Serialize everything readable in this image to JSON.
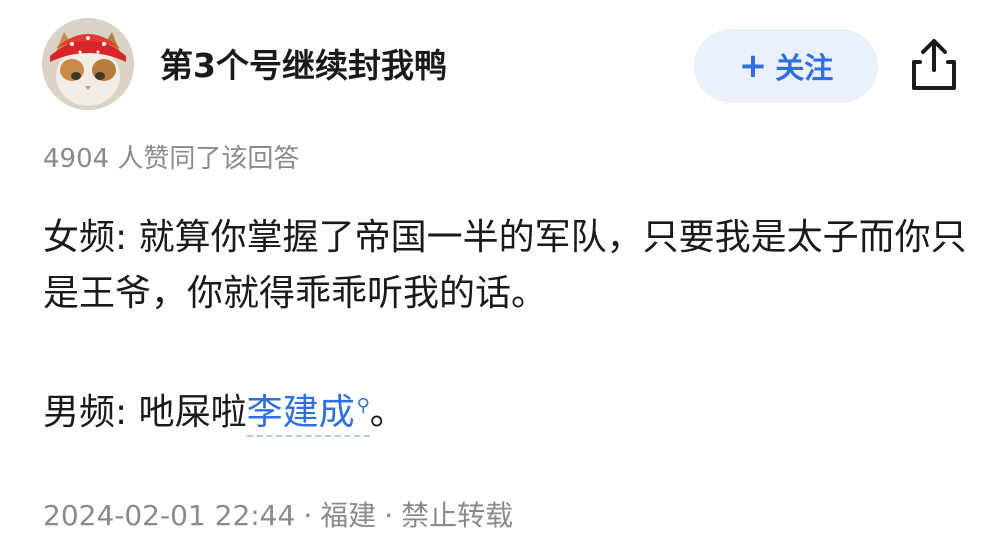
{
  "author": {
    "name": "第3个号继续封我鸭",
    "avatar_alt": "cat-with-red-bandana"
  },
  "actions": {
    "follow_label": "关注",
    "follow_plus": "+",
    "share_icon": "share-icon"
  },
  "answer": {
    "likes_text": "4904 人赞同了该回答",
    "para1": {
      "text": "女频: 就算你掌握了帝国一半的军队，只要我是太子而你只是王爷，你就得乖乖听我的话。"
    },
    "para2": {
      "prefix": "男频: 吔屎啦",
      "link_text": "李建成",
      "suffix": "。"
    }
  },
  "meta": {
    "date": "2024-02-01 22:44",
    "separator": "·",
    "location": "福建",
    "copyright": "禁止转载"
  },
  "colors": {
    "accent": "#2f6fe0",
    "follow_bg": "#eaf1fd",
    "muted_text": "#8a8a8a",
    "body_text": "#1a1a1a"
  }
}
